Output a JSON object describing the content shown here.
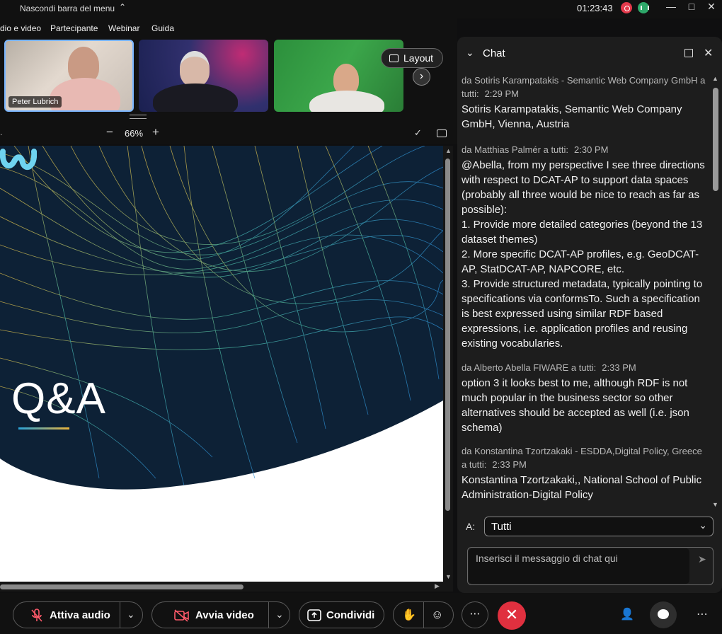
{
  "titlebar": {
    "hide_menu": "Nascondi barra del menu",
    "clock": "01:23:43"
  },
  "menubar": [
    "dio e video",
    "Partecipante",
    "Webinar",
    "Guida"
  ],
  "video_strip": {
    "tile1_name": "Peter Lubrich",
    "layout_label": "Layout"
  },
  "zoom": {
    "percent": "66%"
  },
  "slide": {
    "title": "Q&A"
  },
  "chat": {
    "title": "Chat",
    "messages": [
      {
        "meta": "da Sotiris Karampatakis - Semantic Web Company GmbH a tutti:",
        "time": "2:29 PM",
        "text": "Sotiris Karampatakis, Semantic Web Company GmbH, Vienna, Austria"
      },
      {
        "meta": "da Matthias Palmér a tutti:",
        "time": "2:30 PM",
        "text": "@Abella, from my perspective I see three directions with respect to DCAT-AP to support data spaces (probably all three would be nice to reach as far as possible):\n 1. Provide more detailed categories (beyond the 13 dataset themes)\n 2. More specific DCAT-AP profiles, e.g. GeoDCAT-AP, StatDCAT-AP, NAPCORE, etc.\n 3. Provide structured metadata, typically pointing to specifications via conformsTo. Such a specification is best expressed using similar RDF based expressions, i.e. application profiles and reusing existing vocabularies."
      },
      {
        "meta": "da Alberto Abella FIWARE a tutti:",
        "time": "2:33 PM",
        "text": "option 3 it looks best to me, although RDF is not much popular in the business sector so other alternatives should be accepted as well (i.e. json schema)"
      },
      {
        "meta": "da Konstantina Tzortzakaki - ESDDA,Digital Policy, Greece a tutti:",
        "time": "2:33 PM",
        "text": "Konstantina Tzortzakaki,, National School of Public Administration-Digital Policy"
      }
    ],
    "to_label": "A:",
    "to_value": "Tutti",
    "input_placeholder": "Inserisci il messaggio di chat qui"
  },
  "toolbar": {
    "audio_label": "Attiva audio",
    "video_label": "Avvia video",
    "share_label": "Condividi"
  },
  "colors": {
    "accent_red": "#e0303f",
    "slide_navy": "#0d2136",
    "tile_border": "#7ab6ff"
  }
}
